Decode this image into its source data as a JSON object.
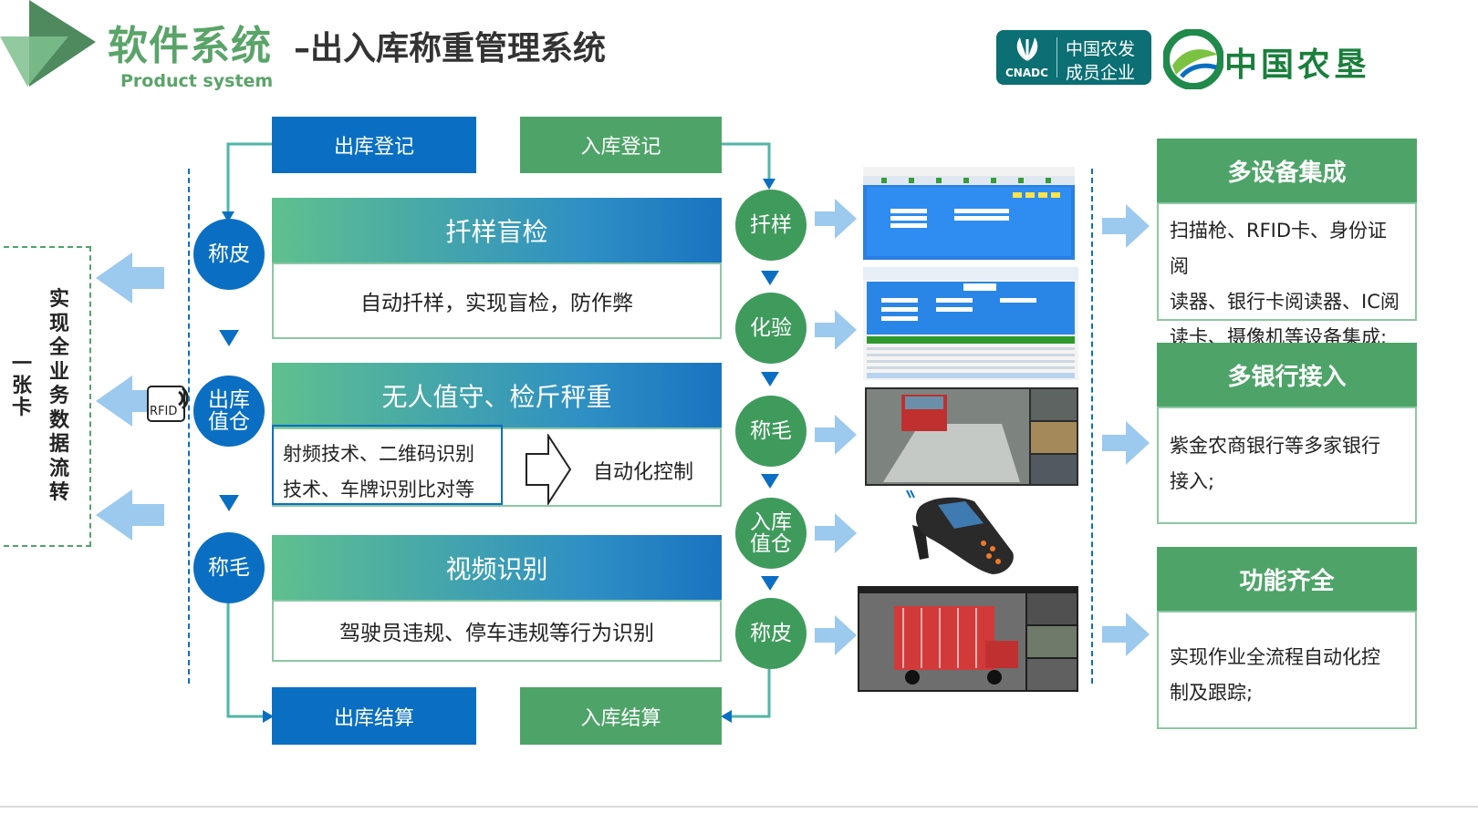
{
  "header": {
    "title": "软件系统",
    "subtitle": "–出入库称重管理系统",
    "title_en": "Product system",
    "cnadc_text": "CNADC",
    "cnadc_line1": "中国农发",
    "cnadc_line2": "成员企业",
    "logo_name": "中国农垦"
  },
  "left_banner": {
    "line1": "实现全业务数据流转",
    "line2": "一张卡"
  },
  "flow": {
    "out_register": "出库登记",
    "in_register": "入库登记",
    "out_settle": "出库结算",
    "in_settle": "入库结算"
  },
  "left_circles": [
    "称皮",
    "出库\n值仓",
    "称毛"
  ],
  "rfid_label": "RFID",
  "features": [
    {
      "title": "扦样盲检",
      "desc": "自动扦样，实现盲检，防作弊"
    },
    {
      "title": "无人值守、检斤秤重",
      "desc_line1": "射频技术、二维码识别",
      "desc_line2": "技术、车牌识别比对等",
      "auto": "自动化控制"
    },
    {
      "title": "视频识别",
      "desc": "驾驶员违规、停车违规等行为识别"
    }
  ],
  "right_circles": [
    "扦样",
    "化验",
    "称毛",
    "入库\n值仓",
    "称皮"
  ],
  "panels": [
    {
      "title": "多设备集成",
      "body": [
        "扫描枪、RFID卡、身份证阅",
        "读器、银行卡阅读器、IC阅",
        "读卡、摄像机等设备集成;"
      ]
    },
    {
      "title": "多银行接入",
      "body": [
        "紫金农商银行等多家银行",
        "接入;"
      ]
    },
    {
      "title": "功能齐全",
      "body": [
        "实现作业全流程自动化控",
        "制及跟踪;"
      ]
    }
  ],
  "colors": {
    "blue": "#0a6fc2",
    "green": "#4ea468",
    "arrow_light": "#9cc9ee"
  }
}
